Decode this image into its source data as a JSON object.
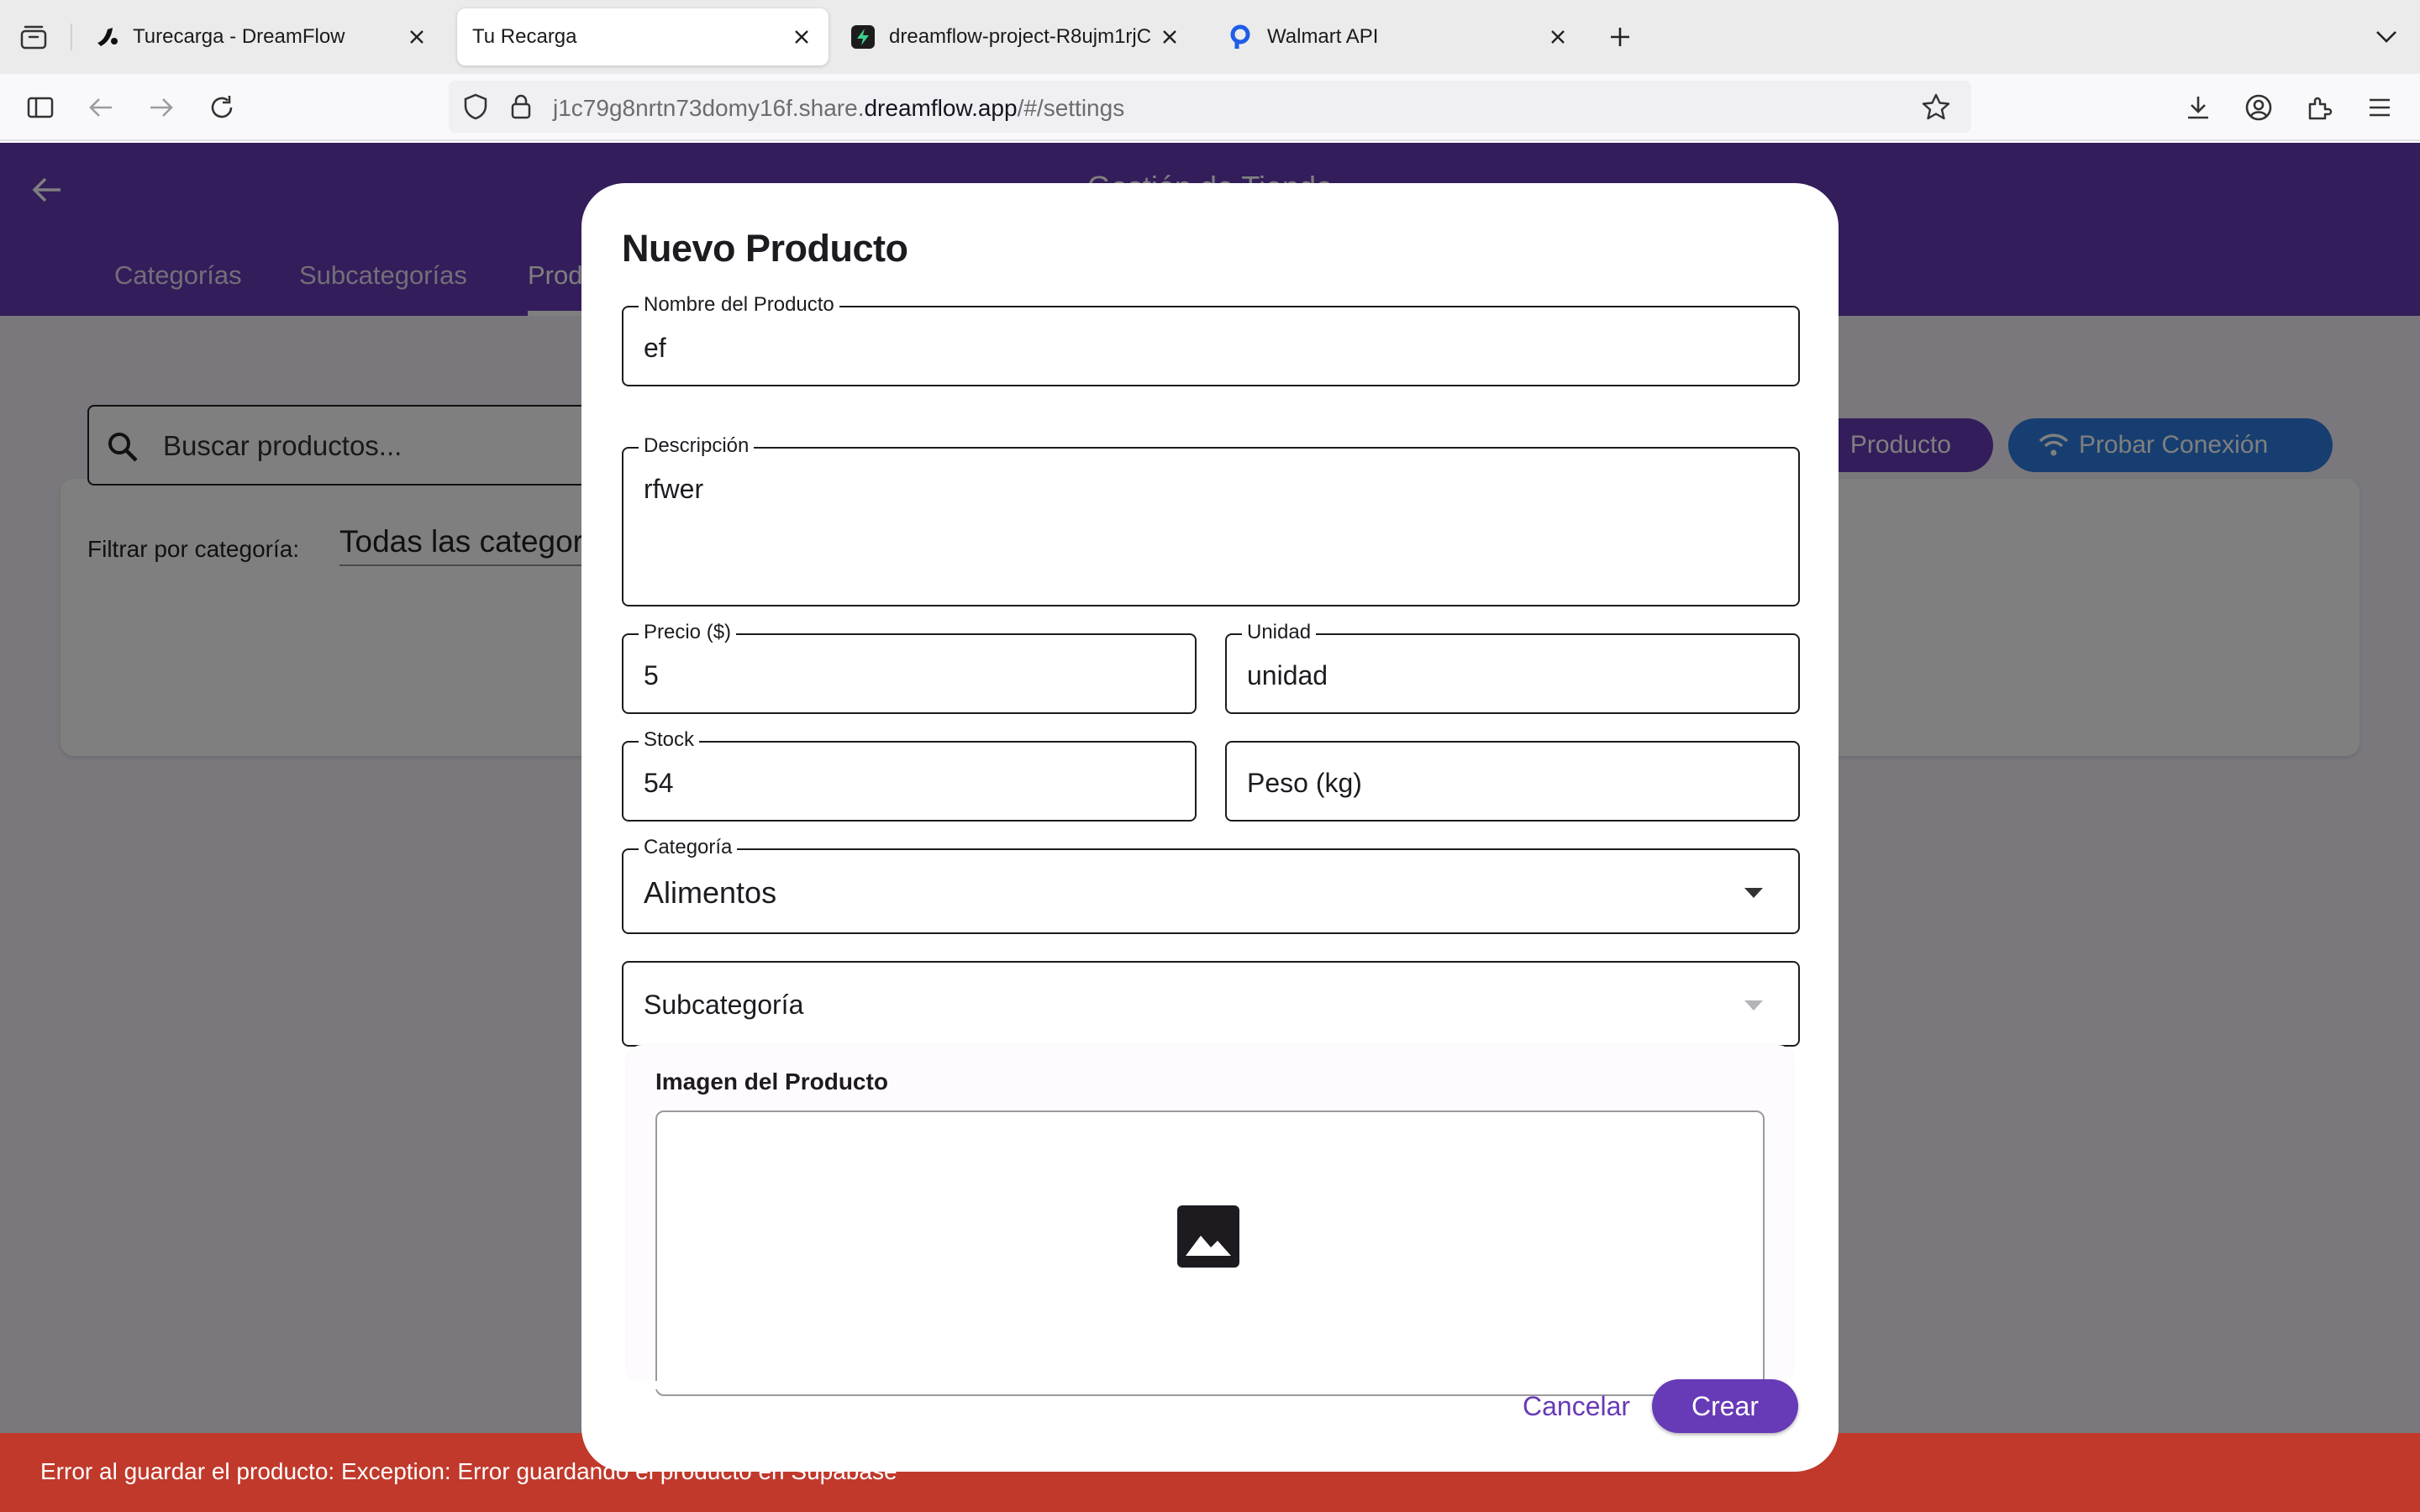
{
  "browser": {
    "tabs": [
      {
        "title": "Turecarga - DreamFlow",
        "active": false,
        "favicon": "dreamflow-logo-icon"
      },
      {
        "title": "Tu Recarga",
        "active": true,
        "favicon": ""
      },
      {
        "title": "dreamflow-project-R8ujm1rjCijV",
        "active": false,
        "favicon": "supabase-logo-icon"
      },
      {
        "title": "Walmart API",
        "active": false,
        "favicon": "rapidapi-logo-icon"
      }
    ],
    "url": {
      "prefix": "j1c79g8nrtn73domy16f.share.",
      "domain": "dreamflow.app",
      "suffix": "/#/settings"
    }
  },
  "app": {
    "title": "Gestión de Tienda",
    "tabs": [
      "Categorías",
      "Subcategorías",
      "Productos"
    ],
    "search_placeholder": "Buscar productos...",
    "filter_label": "Filtrar por categoría:",
    "filter_value": "Todas las categorías",
    "new_product_button": "Producto",
    "test_connection_button": "Probar Conexión",
    "primary_color": "#673ab7",
    "secondary_color": "#2f7de1"
  },
  "dialog": {
    "title": "Nuevo Producto",
    "fields": {
      "name": {
        "label": "Nombre del Producto",
        "value": "ef"
      },
      "description": {
        "label": "Descripción",
        "value": "rfwer"
      },
      "price": {
        "label": "Precio ($)",
        "value": "5"
      },
      "unit": {
        "label": "Unidad",
        "value": "unidad"
      },
      "stock": {
        "label": "Stock",
        "value": "54"
      },
      "weight": {
        "placeholder": "Peso (kg)"
      },
      "category": {
        "label": "Categoría",
        "value": "Alimentos"
      },
      "subcategory": {
        "placeholder": "Subcategoría"
      }
    },
    "image_section_title": "Imagen del Producto",
    "cancel_label": "Cancelar",
    "create_label": "Crear"
  },
  "snackbar": {
    "message": "Error al guardar el producto: Exception: Error guardando el producto en Supabase",
    "color": "#c0392b"
  }
}
